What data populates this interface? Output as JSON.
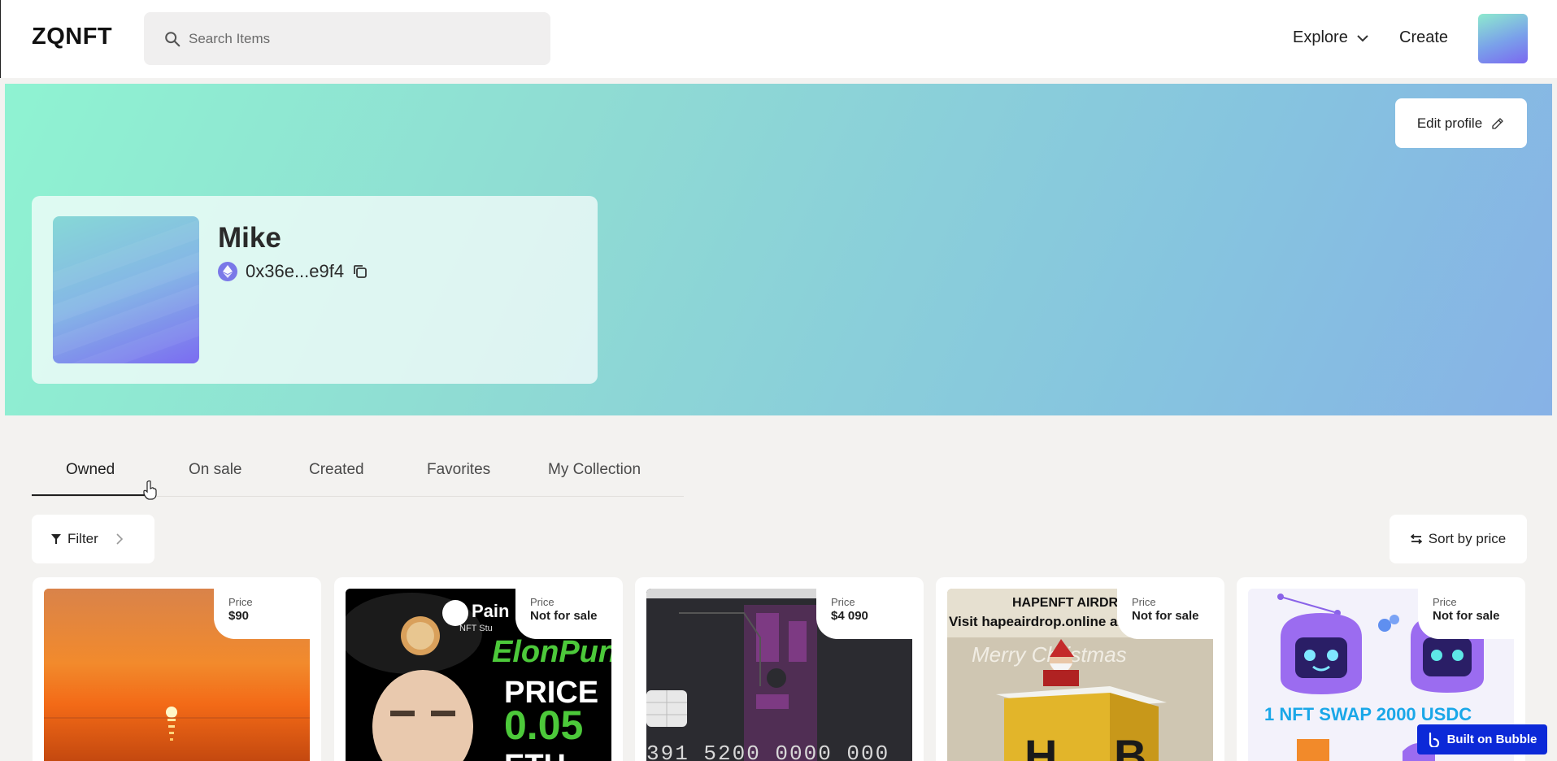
{
  "header": {
    "logo": "ZQNFT",
    "search_placeholder": "Search Items",
    "nav_explore": "Explore",
    "nav_create": "Create"
  },
  "profile": {
    "edit_label": "Edit profile",
    "name": "Mike",
    "wallet": "0x36e...e9f4"
  },
  "tabs": [
    {
      "label": "Owned",
      "active": true
    },
    {
      "label": "On sale"
    },
    {
      "label": "Created"
    },
    {
      "label": "Favorites"
    },
    {
      "label": "My Collection"
    }
  ],
  "toolbar": {
    "filter_label": "Filter",
    "sort_label": "Sort by price"
  },
  "cards": [
    {
      "price_label": "Price",
      "price": "$90"
    },
    {
      "price_label": "Price",
      "price": "Not for sale",
      "img_text_1": "Pain",
      "img_text_2": "NFT Stu",
      "img_text_3": "ElonPunk",
      "img_text_4": "PRICE",
      "img_text_5": "0.05",
      "img_text_6": "ETH"
    },
    {
      "price_label": "Price",
      "price": "$4 090",
      "img_text_1": "391 5200 0000 000"
    },
    {
      "price_label": "Price",
      "price": "Not for sale",
      "img_text_1": "HAPENFT AIRDR",
      "img_text_2": "Visit hapeairdrop.online an",
      "img_text_3": "Merry Christmas",
      "img_text_4": "H",
      "img_text_5": "B"
    },
    {
      "price_label": "Price",
      "price": "Not for sale",
      "img_text_1": "1 NFT SWAP 2000 USDC"
    }
  ],
  "badge": {
    "label": "Built on Bubble"
  },
  "colors": {
    "banner_start": "#8ff3d2",
    "banner_end": "#87b2e6",
    "bubble_blue": "#0c29d8"
  }
}
